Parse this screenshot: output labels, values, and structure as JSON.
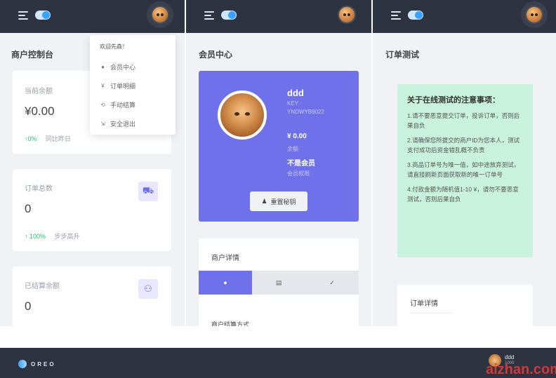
{
  "panel1": {
    "title": "商户控制台",
    "balance": {
      "label": "当前余额",
      "value": "¥0.00",
      "change": "↑0%",
      "compare": "同比昨日"
    },
    "orders": {
      "label": "订单总数",
      "value": "0",
      "change": "↑ 100%",
      "compare": "步步高升",
      "icon": "cart-icon"
    },
    "settled": {
      "label": "已结算余额",
      "value": "0",
      "icon": "users-icon"
    },
    "dropdown": {
      "header": "欢迎先森！",
      "items": [
        {
          "icon": "user-icon",
          "glyph": "●",
          "label": "会员中心"
        },
        {
          "icon": "yen-icon",
          "glyph": "¥",
          "label": "订单明细"
        },
        {
          "icon": "refresh-icon",
          "glyph": "⟲",
          "label": "手动结算"
        },
        {
          "icon": "logout-icon",
          "glyph": "⇲",
          "label": "安全退出"
        }
      ]
    }
  },
  "panel2": {
    "title": "会员中心",
    "member": {
      "name": "ddd",
      "key_label": "KEY",
      "key_value": "YNDWYB9022",
      "balance": "¥ 0.00",
      "balance_label": "余额",
      "status": "不是会员",
      "status_label": "会员权限",
      "reset_button": "重置秘钥"
    },
    "details_title": "商户详情",
    "tabs": [
      {
        "icon": "info-icon",
        "glyph": "●"
      },
      {
        "icon": "list-icon",
        "glyph": "▤"
      },
      {
        "icon": "check-icon",
        "glyph": "✓"
      }
    ],
    "settlement_label": "商户结算方式"
  },
  "panel3": {
    "title": "订单测试",
    "notice": {
      "heading": "关于在线测试的注意事项：",
      "items": [
        "1.请不要恶意提交订单，投诉订单，否则后果自负",
        "2.请确保您所提交的商户ID为您本人，测试支付成功后资金错乱概不负责",
        "3.商品订单号为唯一值，如中途放弃测试，请直接刷新页面获取新的唯一订单号",
        "4.付款金额为随机值1-10 ¥，请勿不要恶意测试，否则后果自负"
      ]
    },
    "details_title": "订单详情"
  },
  "bottom": {
    "logo": "OREO",
    "user_name": "ddd",
    "user_sub": "1000"
  },
  "watermark": "aizhan.com",
  "colors": {
    "topbar": "#2d3340",
    "accent": "#6e71e9",
    "notice": "#c8f1de",
    "green": "#2bbf7a"
  }
}
